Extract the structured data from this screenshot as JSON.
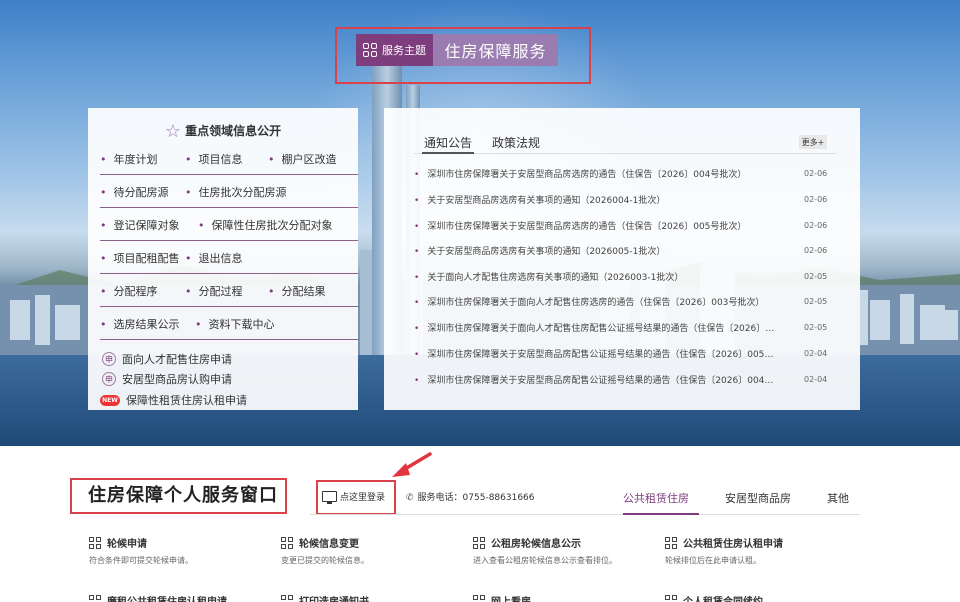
{
  "topic": {
    "tag_label": "服务主题",
    "title": "住房保障服务"
  },
  "left_panel": {
    "title": "重点领域信息公开",
    "rows": [
      [
        "年度计划",
        "项目信息",
        "棚户区改造"
      ],
      [
        "待分配房源",
        "住房批次分配房源"
      ],
      [
        "登记保障对象",
        "保障性住房批次分配对象"
      ],
      [
        "项目配租配售",
        "退出信息"
      ],
      [
        "分配程序",
        "分配过程",
        "分配结果"
      ],
      [
        "选房结果公示",
        "资料下载中心"
      ]
    ],
    "links": [
      "面向人才配售住房申请",
      "安居型商品房认购申请",
      "保障性租赁住房认租申请"
    ],
    "new_badge": "NEW"
  },
  "right_panel": {
    "tabs": [
      "通知公告",
      "政策法规"
    ],
    "more": "更多+",
    "news": [
      {
        "title": "深圳市住房保障署关于安居型商品房选房的通告（住保告〔2026〕004号批次）",
        "date": "02-06"
      },
      {
        "title": "关于安居型商品房选房有关事项的通知（2026004-1批次）",
        "date": "02-06"
      },
      {
        "title": "深圳市住房保障署关于安居型商品房选房的通告（住保告〔2026〕005号批次）",
        "date": "02-06"
      },
      {
        "title": "关于安居型商品房选房有关事项的通知（2026005-1批次）",
        "date": "02-06"
      },
      {
        "title": "关于面向人才配售住房选房有关事项的通知（2026003-1批次）",
        "date": "02-05"
      },
      {
        "title": "深圳市住房保障署关于面向人才配售住房选房的通告（住保告〔2026〕003号批次）",
        "date": "02-05"
      },
      {
        "title": "深圳市住房保障署关于面向人才配售住房配售公证摇号结果的通告（住保告〔2026〕003...",
        "date": "02-05"
      },
      {
        "title": "深圳市住房保障署关于安居型商品房配售公证摇号结果的通告（住保告〔2026〕005号批...",
        "date": "02-04"
      },
      {
        "title": "深圳市住房保障署关于安居型商品房配售公证摇号结果的通告（住保告〔2026〕004号批...",
        "date": "02-04"
      }
    ]
  },
  "window": {
    "title": "住房保障个人服务窗口",
    "login": "点这里登录",
    "phone": "服务电话：0755-88631666",
    "tabs": [
      "公共租赁住房",
      "安居型商品房",
      "其他"
    ]
  },
  "services": [
    {
      "title": "轮候申请",
      "desc": "符合条件即可提交轮候申请。"
    },
    {
      "title": "轮候信息变更",
      "desc": "变更已提交的轮候信息。"
    },
    {
      "title": "公租房轮候信息公示",
      "desc": "进入查看公租房轮候信息公示查看排位。"
    },
    {
      "title": "公共租赁住房认租申请",
      "desc": "轮候排位后在此申请认租。"
    }
  ],
  "services_row2": [
    "廉租公共租赁住房认租申请",
    "打印选房通知书",
    "网上看房",
    "个人租赁合同续约"
  ],
  "colors": {
    "accent": "#7e3d7d",
    "highlight_frame": "#d9424a",
    "topic_name_bg": "#9a7cb1"
  }
}
